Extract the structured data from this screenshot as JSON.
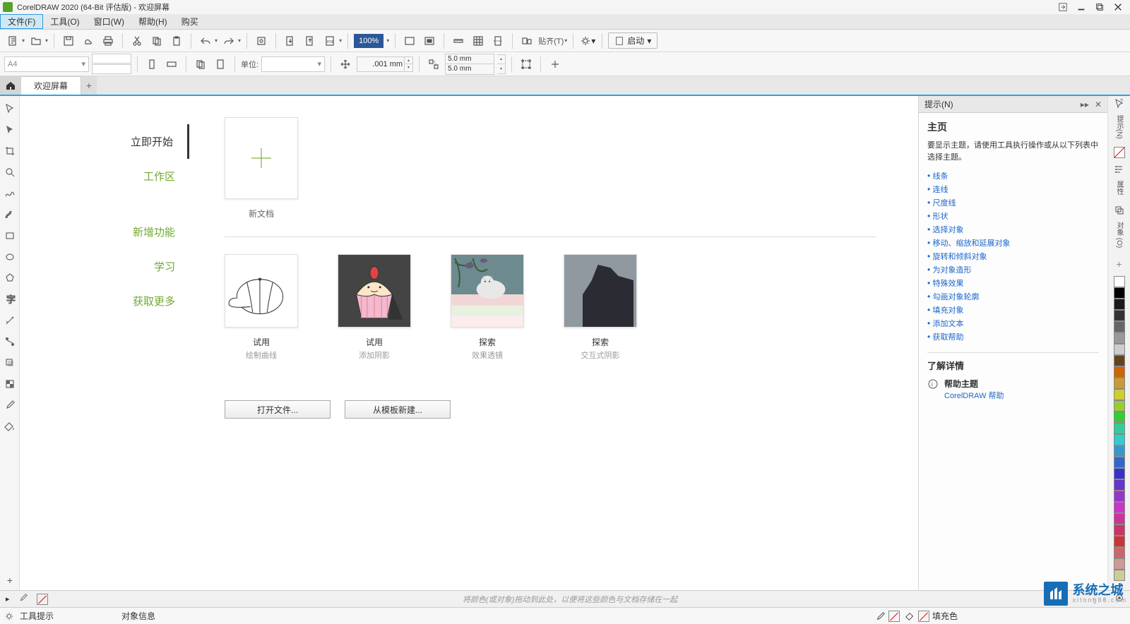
{
  "title": "CorelDRAW 2020 (64-Bit 评估版) - 欢迎屏幕",
  "menu": {
    "file": "文件(F)",
    "tools": "工具(O)",
    "window": "窗口(W)",
    "help": "帮助(H)",
    "buy": "购买"
  },
  "toolbar1": {
    "zoom": "100%",
    "snap": "贴齐(T)",
    "launch": "启动"
  },
  "toolbar2": {
    "pagesize": "A4",
    "unit_label": "单位:",
    "nudge": ".001 mm",
    "dup_x": "5.0 mm",
    "dup_y": "5.0 mm"
  },
  "tabs": {
    "welcome": "欢迎屏幕"
  },
  "welcome": {
    "nav": {
      "start": "立即开始",
      "workspace": "工作区",
      "whatsnew": "新增功能",
      "learn": "学习",
      "getmore": "获取更多"
    },
    "new_doc": "新文档",
    "templates": [
      {
        "title": "试用",
        "sub": "绘制曲线"
      },
      {
        "title": "试用",
        "sub": "添加阴影"
      },
      {
        "title": "探索",
        "sub": "效果透镜"
      },
      {
        "title": "探索",
        "sub": "交互式阴影"
      }
    ],
    "open_file": "打开文件...",
    "from_template": "从模板新建..."
  },
  "hints": {
    "panel_title": "提示(N)",
    "heading": "主页",
    "intro": "要显示主题，请使用工具执行操作或从以下列表中选择主题。",
    "topics": [
      "线条",
      "连线",
      "尺度线",
      "形状",
      "选择对象",
      "移动、缩放和延展对象",
      "旋转和倾斜对象",
      "为对象造形",
      "特殊效果",
      "勾画对象轮廓",
      "填充对象",
      "添加文本",
      "获取帮助"
    ],
    "details": "了解详情",
    "help_topic": "帮助主题",
    "help_link": "CorelDRAW 帮助"
  },
  "right_tabs": {
    "hints": "提示(N)",
    "props": "属性",
    "objects": "对象 (O)"
  },
  "dock": {
    "hint": "将颜色(或对象)拖动到此处，以便将这些颜色与文档存储在一起"
  },
  "status": {
    "tooltips": "工具提示",
    "object_info": "对象信息",
    "fill": "填充色"
  },
  "watermark": {
    "cn": "系统之城",
    "en": "xitong86.com"
  },
  "colors": [
    "#ffffff",
    "#000000",
    "#1a1a1a",
    "#333333",
    "#666666",
    "#999999",
    "#cccccc",
    "#654321",
    "#cc6600",
    "#cc9933",
    "#cccc33",
    "#99cc33",
    "#33cc33",
    "#33cc99",
    "#33cccc",
    "#3399cc",
    "#3366cc",
    "#3333cc",
    "#6633cc",
    "#9933cc",
    "#cc33cc",
    "#cc3399",
    "#cc3366",
    "#cc3333",
    "#cc6666",
    "#cc9999",
    "#cccc99"
  ]
}
